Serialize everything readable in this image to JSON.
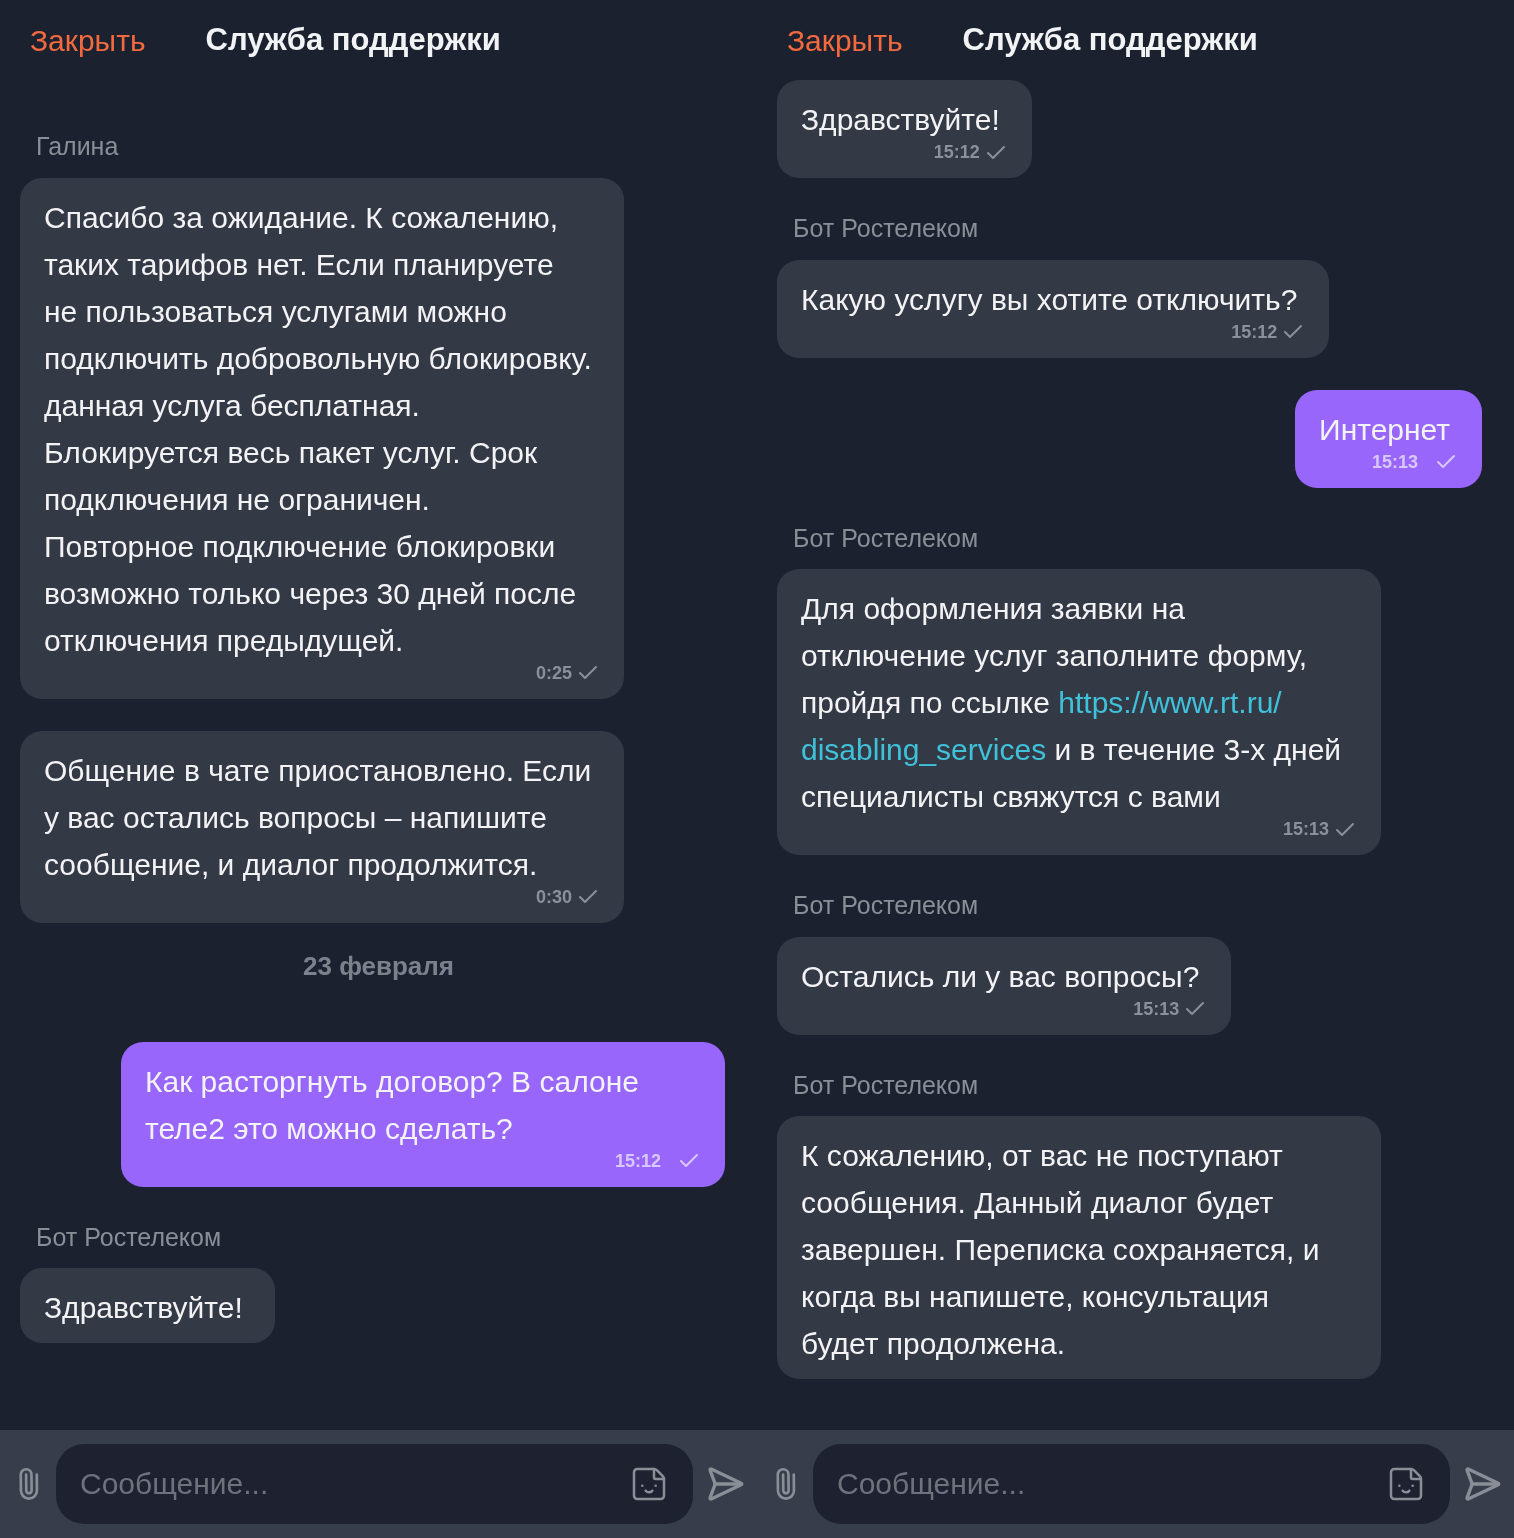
{
  "panels": [
    {
      "header": {
        "close": "Закрыть",
        "title": "Служба поддержки"
      },
      "messages": [
        {
          "kind": "message",
          "sender": "Галина",
          "outgoing": false,
          "segments": [
            {
              "kind": "text",
              "text": "Спасибо за ожидание. К сожалению, таких тарифов нет. Если планируете не пользоваться услугами можно подключить добровольную блокировку. данная услуга бесплатная. Блокируется весь пакет услуг. Срок подключения не ограничен.  Повторное подключение блокировки возможно только через 30 дней после отключения предыдущей."
            }
          ],
          "time": "0:25"
        },
        {
          "kind": "message",
          "outgoing": false,
          "segments": [
            {
              "kind": "text",
              "text": "Общение в чате приостановлено. Если у вас остались вопросы – напишите сообщение, и диалог продолжится."
            }
          ],
          "time": "0:30"
        },
        {
          "kind": "date",
          "text": "23 февраля"
        },
        {
          "kind": "message",
          "outgoing": true,
          "segments": [
            {
              "kind": "text",
              "text": "Как расторгнуть договор? В салоне теле2 это можно сделать?"
            }
          ],
          "time": "15:12"
        },
        {
          "kind": "message",
          "sender": "Бот Ростелеком",
          "outgoing": false,
          "segments": [
            {
              "kind": "text",
              "text": "Здравствуйте!"
            }
          ]
        }
      ],
      "composer": {
        "placeholder": "Сообщение..."
      }
    },
    {
      "header": {
        "close": "Закрыть",
        "title": "Служба поддержки"
      },
      "messages": [
        {
          "kind": "message",
          "outgoing": false,
          "segments": [
            {
              "kind": "text",
              "text": "Здравствуйте!"
            }
          ],
          "time": "15:12"
        },
        {
          "kind": "message",
          "sender": "Бот Ростелеком",
          "outgoing": false,
          "segments": [
            {
              "kind": "text",
              "text": "Какую услугу вы хотите отключить?"
            }
          ],
          "time": "15:12"
        },
        {
          "kind": "message",
          "outgoing": true,
          "segments": [
            {
              "kind": "text",
              "text": "Интернет"
            }
          ],
          "time": "15:13"
        },
        {
          "kind": "message",
          "sender": "Бот Ростелеком",
          "outgoing": false,
          "segments": [
            {
              "kind": "text",
              "text": "Для оформления заявки на отключение услуг заполните форму, пройдя по ссылке "
            },
            {
              "kind": "link",
              "text": "https://www.rt.ru/"
            },
            {
              "kind": "link",
              "text": "disabling_services"
            },
            {
              "kind": "text",
              "text": " и в течение 3-х дней специалисты свяжутся с вами"
            }
          ],
          "time": "15:13"
        },
        {
          "kind": "message",
          "sender": "Бот Ростелеком",
          "outgoing": false,
          "segments": [
            {
              "kind": "text",
              "text": "Остались ли у вас вопросы?"
            }
          ],
          "time": "15:13"
        },
        {
          "kind": "message",
          "sender": "Бот Ростелеком",
          "outgoing": false,
          "segments": [
            {
              "kind": "text",
              "text": "К сожалению, от вас не поступают сообщения. Данный диалог будет завершен. Переписка сохраняется, и когда вы напишете, консультация будет продолжена."
            }
          ]
        }
      ],
      "composer": {
        "placeholder": "Сообщение..."
      }
    }
  ]
}
